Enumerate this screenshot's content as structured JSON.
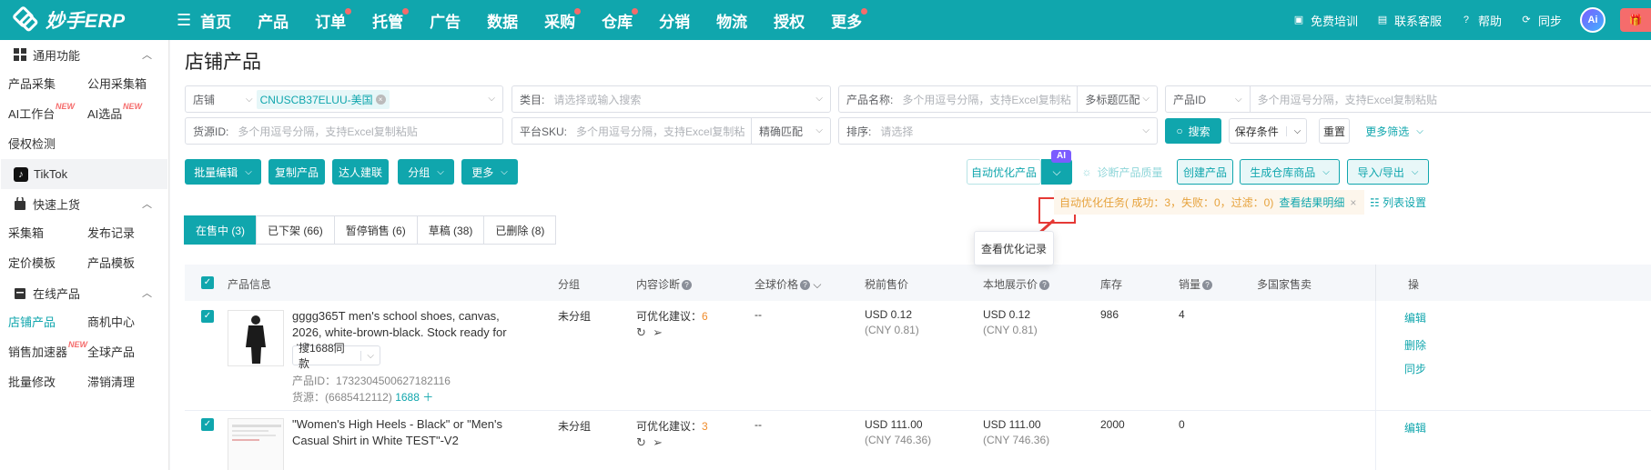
{
  "brand": {
    "name": "妙手ERP"
  },
  "nav": [
    {
      "label": "首页",
      "dot": false
    },
    {
      "label": "产品",
      "dot": false
    },
    {
      "label": "订单",
      "dot": true
    },
    {
      "label": "托管",
      "dot": true
    },
    {
      "label": "广告",
      "dot": false
    },
    {
      "label": "数据",
      "dot": false
    },
    {
      "label": "采购",
      "dot": true
    },
    {
      "label": "仓库",
      "dot": true
    },
    {
      "label": "分销",
      "dot": false
    },
    {
      "label": "物流",
      "dot": false
    },
    {
      "label": "授权",
      "dot": false
    },
    {
      "label": "更多",
      "dot": true
    }
  ],
  "topRight": {
    "training": "免费培训",
    "service": "联系客服",
    "help": "帮助",
    "sync": "同步",
    "ai": "Ai"
  },
  "sidebar": {
    "section1": "通用功能",
    "items1": [
      {
        "label": "产品采集",
        "new": false
      },
      {
        "label": "公用采集箱",
        "new": false
      },
      {
        "label": "AI工作台",
        "new": true
      },
      {
        "label": "AI选品",
        "new": true
      },
      {
        "label": "侵权检测",
        "new": false
      }
    ],
    "tiktok": "TikTok",
    "section2": "快速上货",
    "items2": [
      {
        "label": "采集箱",
        "new": false
      },
      {
        "label": "发布记录",
        "new": false
      },
      {
        "label": "定价模板",
        "new": false
      },
      {
        "label": "产品模板",
        "new": false
      }
    ],
    "section3": "在线产品",
    "items3": [
      {
        "label": "店铺产品",
        "new": false,
        "active": true
      },
      {
        "label": "商机中心",
        "new": false
      },
      {
        "label": "销售加速器",
        "new": true
      },
      {
        "label": "全球产品",
        "new": false
      },
      {
        "label": "批量修改",
        "new": false
      },
      {
        "label": "滞销清理",
        "new": false
      }
    ],
    "newBadge": "NEW"
  },
  "page": {
    "title": "店铺产品"
  },
  "filters": {
    "store": "店铺",
    "storeTag": "CNUSCB37ELUU-美国",
    "category": "类目:",
    "categoryPh": "请选择或输入搜索",
    "productName": "产品名称:",
    "productNamePh": "多个用逗号分隔，支持Excel复制粘",
    "multiMatch": "多标题匹配",
    "productId": "产品ID",
    "productIdPh": "多个用逗号分隔，支持Excel复制粘贴",
    "sourceId": "货源ID:",
    "sourceIdPh": "多个用逗号分隔，支持Excel复制粘贴",
    "platformSku": "平台SKU:",
    "platformSkuPh": "多个用逗号分隔，支持Excel复制粘",
    "exactMatch": "精确匹配",
    "sort": "排序:",
    "sortPh": "请选择",
    "search": "搜索",
    "saveCond": "保存条件",
    "reset": "重置",
    "moreFilter": "更多筛选"
  },
  "toolbar": {
    "batchEdit": "批量编辑",
    "copy": "复制产品",
    "influencer": "达人建联",
    "group": "分组",
    "more": "更多",
    "autoOptimize": "自动优化产品",
    "diagnose": "诊断产品质量",
    "create": "创建产品",
    "genWarehouse": "生成仓库商品",
    "importExport": "导入/导出",
    "aiMark": "AI"
  },
  "tabs": [
    {
      "label": "在售中 (3)",
      "active": true
    },
    {
      "label": "已下架 (66)"
    },
    {
      "label": "暂停销售 (6)"
    },
    {
      "label": "草稿 (38)"
    },
    {
      "label": "已删除 (8)"
    }
  ],
  "popup": {
    "label": "查看优化记录"
  },
  "notice": {
    "text": "自动优化任务( 成功：3，失败：0，过滤：0)",
    "link": "查看结果明细",
    "close": "×",
    "listSettings": "列表设置"
  },
  "tableHead": {
    "info": "产品信息",
    "group": "分组",
    "content": "内容诊断",
    "globalPrice": "全球价格",
    "preTax": "税前售价",
    "local": "本地展示价",
    "stock": "库存",
    "sales": "销量",
    "multi": "多国家售卖",
    "ops": "操"
  },
  "rows": [
    {
      "title": "gggg365T men's school shoes, canvas, 2026, white-brown-black. Stock ready for delivery! ...",
      "search1688": "搜1688同款",
      "productIdLabel": "产品ID：",
      "productId": "1732304500627182116",
      "sourceLabel": "货源：",
      "source": "(6685412112)",
      "link1688": "1688 ＋",
      "group": "未分组",
      "optLabel": "可优化建议：",
      "optCount": "6",
      "globalPrice": "--",
      "preTax": "USD 0.12",
      "preTaxCny": "(CNY 0.81)",
      "local": "USD 0.12",
      "localCny": "(CNY 0.81)",
      "stock": "986",
      "sales": "4",
      "ops": [
        "编辑",
        "删除",
        "同步"
      ]
    },
    {
      "title": "\"Women's High Heels - Black\" or \"Men's Casual Shirt in White TEST\"-V2",
      "group": "未分组",
      "optLabel": "可优化建议：",
      "optCount": "3",
      "globalPrice": "--",
      "preTax": "USD 111.00",
      "preTaxCny": "(CNY 746.36)",
      "local": "USD 111.00",
      "localCny": "(CNY 746.36)",
      "stock": "2000",
      "sales": "0",
      "ops": [
        "编辑"
      ]
    }
  ]
}
